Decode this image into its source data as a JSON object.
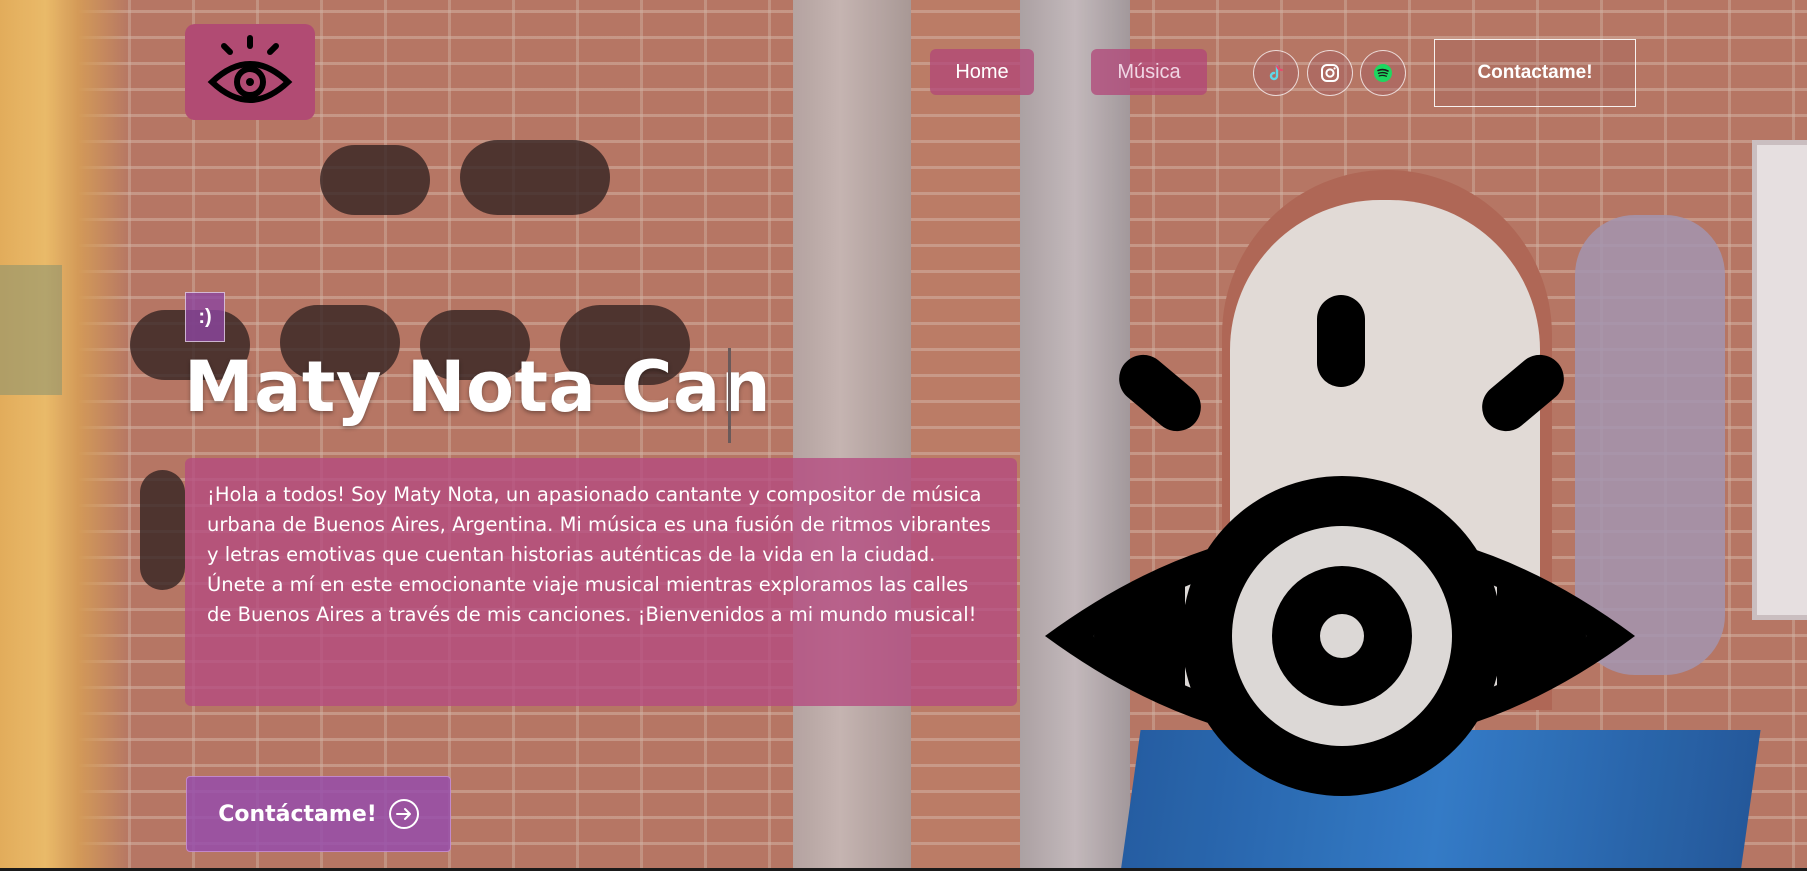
{
  "header": {
    "logo_icon": "eye-icon",
    "nav": [
      {
        "label": "Home"
      },
      {
        "label": "Música"
      }
    ],
    "social": [
      {
        "icon": "tiktok-icon",
        "color": "#5fd8e6"
      },
      {
        "icon": "instagram-icon",
        "color": "#ffffff"
      },
      {
        "icon": "spotify-icon",
        "color": "#1ed760"
      }
    ],
    "contact_label": "Contactame!"
  },
  "hero": {
    "badge": ":)",
    "title": "Maty Nota Can",
    "bio": "¡Hola a todos! Soy Maty Nota, un apasionado cantante y compositor de música urbana de Buenos Aires, Argentina. Mi música es una fusión de ritmos vibrantes y letras emotivas que cuentan historias auténticas de la vida en la ciudad. Únete a mí en este emocionante viaje musical mientras exploramos las calles de Buenos Aires a través de mis canciones. ¡Bienvenidos a mi mundo musical!",
    "cta_label": "Contáctame!",
    "cta_icon": "arrow-right-circle-icon",
    "illustration_icon": "eye-icon"
  },
  "colors": {
    "accent_pink": "#b14b73",
    "accent_purple": "#964eaa",
    "white": "#ffffff"
  }
}
